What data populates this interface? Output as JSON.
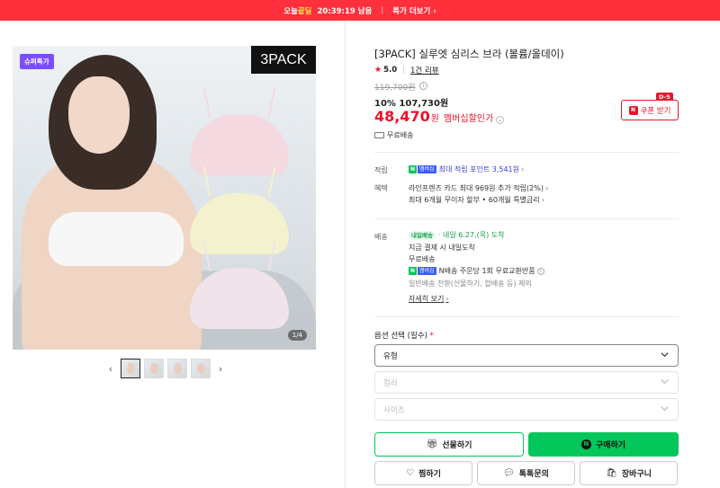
{
  "topbar": {
    "brand_a": "오늘",
    "brand_b": "끝딜",
    "timer": "20:39:19 남음",
    "more": "특가 더보기"
  },
  "gallery": {
    "badge": "슈퍼특가",
    "pack_label": "3PACK",
    "counter": "1/4",
    "prev": "‹",
    "next": "›",
    "thumb_count": 4
  },
  "product": {
    "title": "[3PACK] 실루엣 심리스 브라 (볼륨/올데이)",
    "rating": "5.0",
    "reviews": "1건 리뷰",
    "original_price": "119,700원",
    "discount": "10% 107,730원",
    "price": "48,470",
    "price_unit": "원",
    "member_label": "멤버십할인가",
    "coupon_dday": "D-5",
    "coupon_label": "쿠폰 받기",
    "coupon_badge": "N",
    "free_shipping": "무료배송"
  },
  "benefits": {
    "points_label": "적립",
    "points_text": "최대 적립 포인트 3,541원",
    "benefit_label": "혜택",
    "benefit_line1": "라인프렌즈 카드 최대 969원 추가 적립(2%)",
    "benefit_line2": "최대 6개월 무이자 할부 • 60개월 특별금리"
  },
  "delivery": {
    "label": "배송",
    "naeil_badge": "내일배송",
    "arrival": "내일 6.27.(목) 도착",
    "line1": "지금 결제 시 내일도착",
    "line2": "무료배송",
    "return_text": "N배송 주문당 1회 무료교환반품",
    "line4": "일반배송 전환(선물하기, 합배송 등) 제외",
    "more": "자세히 보기"
  },
  "npay": {
    "n": "N",
    "plus": "멤버십"
  },
  "options": {
    "label": "옵션 선택 (필수)",
    "required_mark": "*",
    "select1": "유형",
    "select2": "컬러",
    "select3": "사이즈"
  },
  "actions": {
    "gift": "선물하기",
    "buy": "구매하기",
    "buy_logo": "N",
    "wish": "찜하기",
    "talk": "톡톡문의",
    "cart": "장바구니"
  },
  "colors": {
    "accent_red": "#e8142b",
    "topbar_red": "#ff2f3b",
    "naver_green": "#03c75a"
  }
}
